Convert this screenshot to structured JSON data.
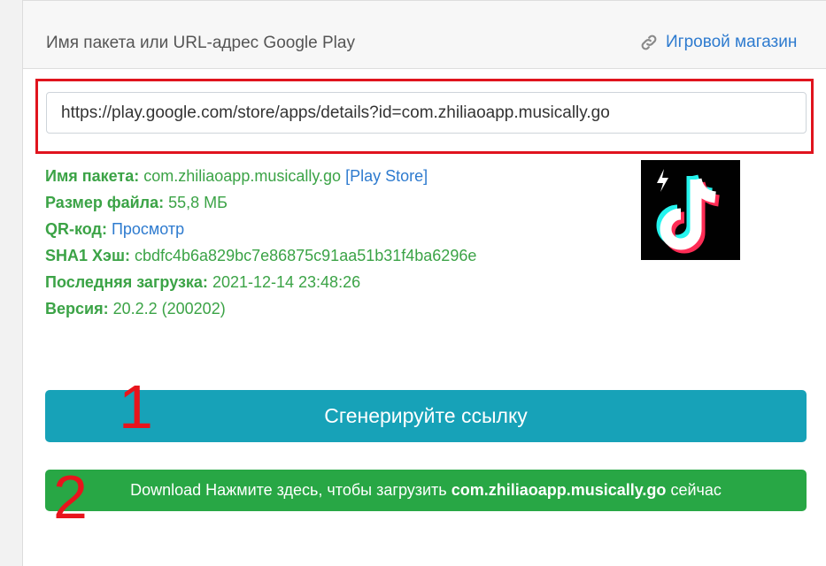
{
  "header": {
    "title": "Имя пакета или URL-адрес Google Play",
    "store_link": "Игровой магазин",
    "store_icon": "link-icon"
  },
  "url_input": {
    "value": "https://play.google.com/store/apps/details?id=com.zhiliaoapp.musically.go"
  },
  "info": {
    "package_label": "Имя пакета:",
    "package_value": "com.zhiliaoapp.musically.go",
    "play_store_link": "[Play Store]",
    "size_label": "Размер файла:",
    "size_value": "55,8 МБ",
    "qr_label": "QR-код:",
    "qr_link": "Просмотр",
    "sha_label": "SHA1 Хэш:",
    "sha_value": "cbdfc4b6a829bc7e86875c91aa51b31f4ba6296e",
    "last_label": "Последняя загрузка:",
    "last_value": "2021-12-14 23:48:26",
    "version_label": "Версия:",
    "version_value": "20.2.2 (200202)"
  },
  "app_icon": "tiktok-lite-icon",
  "buttons": {
    "generate": "Сгенерируйте ссылку",
    "download_prefix": "Download Нажмите здесь, чтобы загрузить",
    "download_package": "com.zhiliaoapp.musically.go",
    "download_suffix": "сейчас"
  },
  "annotations": {
    "first": "1",
    "second": "2"
  },
  "colors": {
    "accent_green": "#3ba346",
    "link_blue": "#2e7bcf",
    "generate_button": "#17a2b8",
    "download_button": "#28a745",
    "highlight_red": "#e0141e"
  }
}
